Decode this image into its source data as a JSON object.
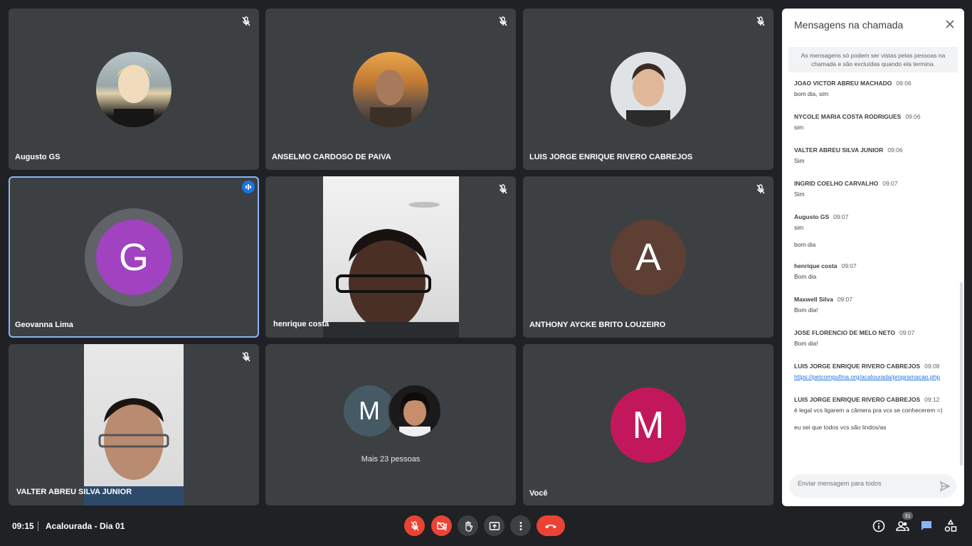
{
  "tiles": [
    {
      "name": "Augusto GS"
    },
    {
      "name": "ANSELMO CARDOSO DE PAIVA"
    },
    {
      "name": "LUIS JORGE ENRIQUE RIVERO CABREJOS"
    },
    {
      "name": "Geovanna Lima",
      "initial": "G"
    },
    {
      "name": "henrique costa"
    },
    {
      "name": "ANTHONY AYCKE BRITO LOUZEIRO",
      "initial": "A"
    },
    {
      "name": "VALTER ABREU SILVA JUNIOR"
    },
    {
      "initial": "M",
      "more": "Mais 23 pessoas"
    },
    {
      "name": "Você",
      "initial": "M"
    }
  ],
  "chat": {
    "title": "Mensagens na chamada",
    "notice": "As mensagens só podem ser vistas pelas pessoas na chamada e são excluídas quando ela termina.",
    "messages": [
      {
        "sender": "JOAO VICTOR ABREU MACHADO",
        "time": "09:06",
        "text": "bom dia, sim"
      },
      {
        "sender": "NYCOLE MARIA COSTA RODRIGUES",
        "time": "09:06",
        "text": "sim"
      },
      {
        "sender": "VALTER ABREU SILVA JUNIOR",
        "time": "09:06",
        "text": "Sim"
      },
      {
        "sender": "INGRID COELHO CARVALHO",
        "time": "09:07",
        "text": "Sim"
      },
      {
        "sender": "Augusto GS",
        "time": "09:07",
        "text": "sim",
        "extra": "bom dia"
      },
      {
        "sender": "henrique costa",
        "time": "09:07",
        "text": "Bom dia"
      },
      {
        "sender": "Maxwell Silva",
        "time": "09:07",
        "text": "Bom dia!"
      },
      {
        "sender": "JOSE FLORENCIO DE MELO NETO",
        "time": "09:07",
        "text": "Bom dia!"
      },
      {
        "sender": "LUIS JORGE ENRIQUE RIVERO CABREJOS",
        "time": "09:08",
        "link": "https://petcompufma.org/acalourada/programacao.php"
      },
      {
        "sender": "LUIS JORGE ENRIQUE RIVERO CABREJOS",
        "time": "09:12",
        "text": "é legal vcs ligarem a câmera pra vcs se conhecerem =)",
        "extra": "eu sei que todos vcs são lindos/as"
      }
    ],
    "input_placeholder": "Enviar mensagem para todos"
  },
  "bottom": {
    "clock": "09:15",
    "meeting_title": "Acalourada - Dia 01",
    "participants_count": "31"
  },
  "colors": {
    "background": "#202124",
    "tile": "#3c4043",
    "end_call": "#ea4335",
    "accent": "#8ab4f8",
    "geovanna_avatar": "#a142c1",
    "anthony_avatar": "#5d3f33",
    "you_avatar": "#c2185b",
    "m_avatar": "#455a64"
  }
}
